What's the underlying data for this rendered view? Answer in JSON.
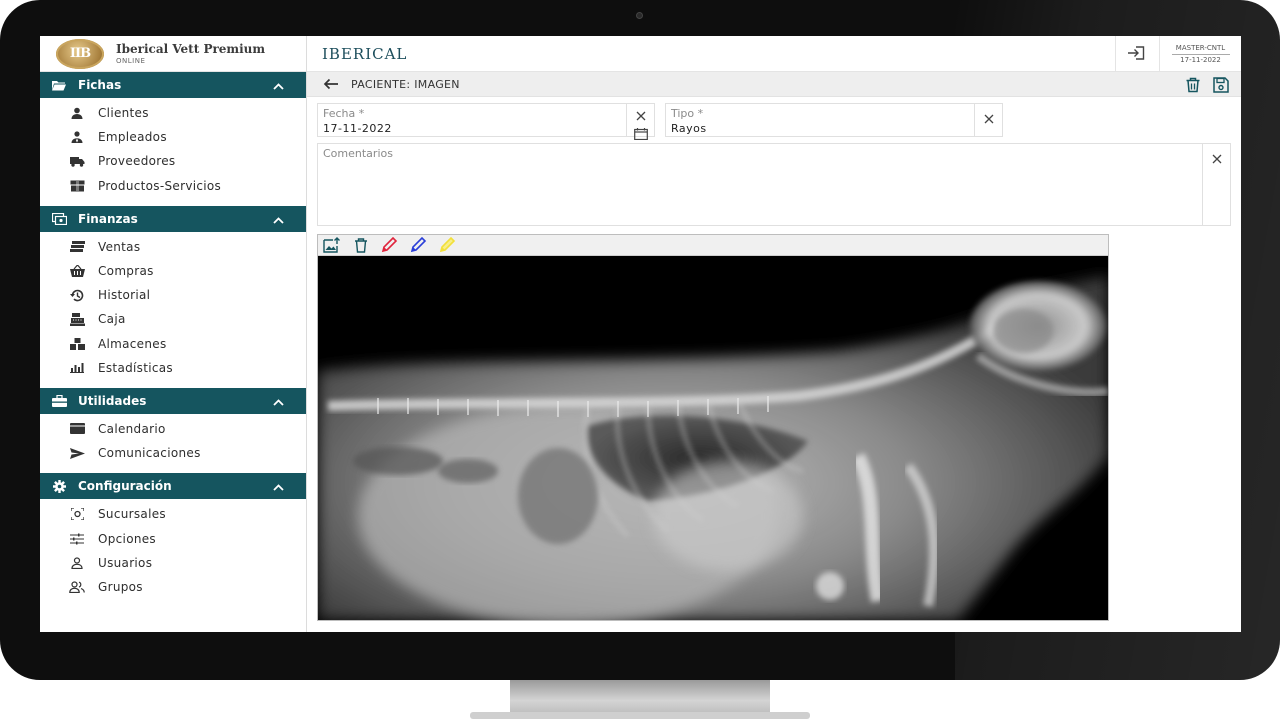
{
  "brand": {
    "title": "Iberical Vett Premium",
    "subtitle": "ONLINE",
    "logo_text": "IIB"
  },
  "sidebar": {
    "sections": [
      {
        "label": "Fichas",
        "icon": "folder-icon",
        "items": [
          {
            "label": "Clientes",
            "icon": "person-icon"
          },
          {
            "label": "Empleados",
            "icon": "employee-icon"
          },
          {
            "label": "Proveedores",
            "icon": "truck-icon"
          },
          {
            "label": "Productos-Servicios",
            "icon": "box-icon"
          }
        ]
      },
      {
        "label": "Finanzas",
        "icon": "money-icon",
        "items": [
          {
            "label": "Ventas",
            "icon": "cash-stack-icon"
          },
          {
            "label": "Compras",
            "icon": "basket-icon"
          },
          {
            "label": "Historial",
            "icon": "history-icon"
          },
          {
            "label": "Caja",
            "icon": "register-icon"
          },
          {
            "label": "Almacenes",
            "icon": "boxes-icon"
          },
          {
            "label": "Estadísticas",
            "icon": "bar-chart-icon"
          }
        ]
      },
      {
        "label": "Utilidades",
        "icon": "toolbox-icon",
        "items": [
          {
            "label": "Calendario",
            "icon": "calendar-icon"
          },
          {
            "label": "Comunicaciones",
            "icon": "send-icon"
          }
        ]
      },
      {
        "label": "Configuración",
        "icon": "gear-icon",
        "items": [
          {
            "label": "Sucursales",
            "icon": "branch-icon"
          },
          {
            "label": "Opciones",
            "icon": "sliders-icon"
          },
          {
            "label": "Usuarios",
            "icon": "user-outline-icon"
          },
          {
            "label": "Grupos",
            "icon": "group-icon"
          }
        ]
      }
    ]
  },
  "topbar": {
    "app_title": "IBERICAL",
    "master_label": "MASTER-CNTL",
    "master_date": "17-11-2022"
  },
  "subbar": {
    "title": "PACIENTE: IMAGEN"
  },
  "form": {
    "fecha": {
      "label": "Fecha *",
      "value": "17-11-2022"
    },
    "tipo": {
      "label": "Tipo *",
      "value": "Rayos"
    },
    "comentarios": {
      "label": "Comentarios",
      "value": ""
    }
  },
  "colors": {
    "accent": "#15555f",
    "title": "#1d4e5c",
    "pen_red": "#e0243c",
    "pen_blue": "#2a3ed8",
    "pen_yellow": "#f2e03a"
  }
}
